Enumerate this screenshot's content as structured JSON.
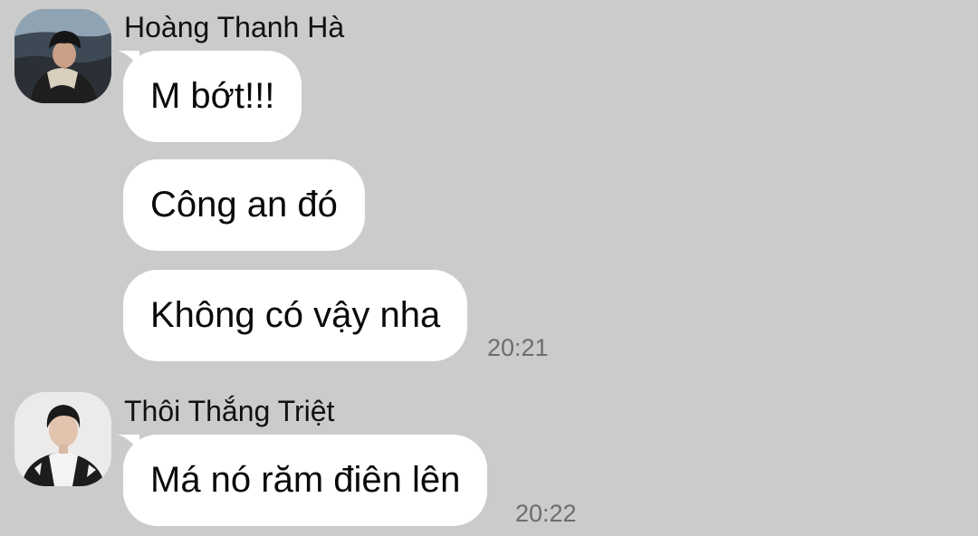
{
  "messages": [
    {
      "sender": "Hoàng Thanh Hà",
      "avatar_icon": "user-avatar-photo",
      "bubbles": [
        "M bớt!!!",
        "Công an đó",
        "Không có vậy nha"
      ],
      "time": "20:21"
    },
    {
      "sender": "Thôi Thắng Triệt",
      "avatar_icon": "user-avatar-photo",
      "bubbles": [
        "Má nó răm điên lên"
      ],
      "time": "20:22"
    }
  ],
  "colors": {
    "background": "#cbcbcb",
    "bubble": "#ffffff",
    "timestamp": "#6d6d6d"
  }
}
